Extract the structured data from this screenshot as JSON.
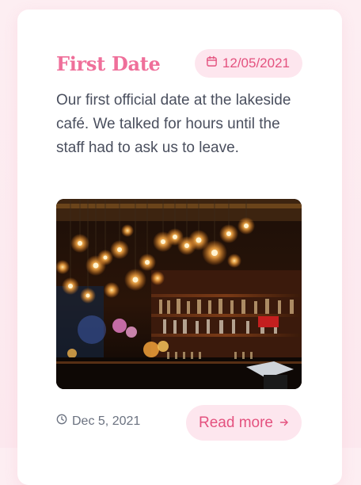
{
  "card": {
    "title": "First Date",
    "date_badge": "12/05/2021",
    "description": "Our first official date at the lakeside café. We talked for hours until the staff had to ask us to leave.",
    "footer_date": "Dec 5, 2021",
    "read_more_label": "Read more",
    "icons": {
      "badge": "calendar-icon",
      "footer": "clock-icon",
      "read_more": "arrow-right-icon"
    },
    "colors": {
      "accent": "#ef6f9a",
      "badge_bg": "#fde6ee",
      "badge_text": "#e4527f",
      "body_text": "#4a4f5e",
      "muted_text": "#6b7280"
    }
  }
}
